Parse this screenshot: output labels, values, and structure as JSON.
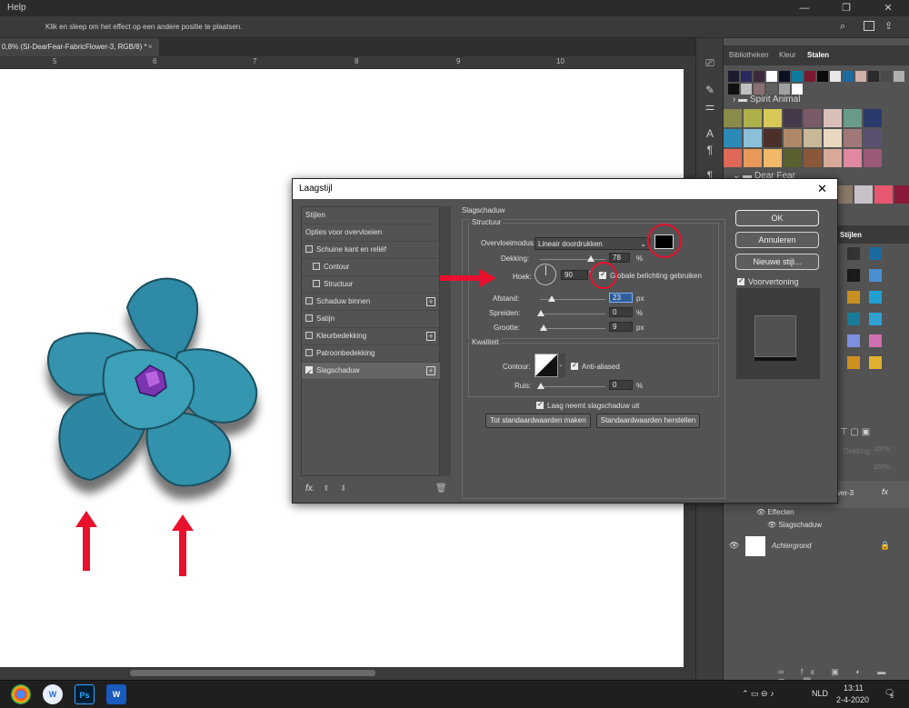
{
  "app": {
    "menu_label": "Help",
    "hint": "Klik en sleep om het effect op een andere positie te plaatsen.",
    "doc_tab": "0,8% (SI-DearFear-FabricFlower-3, RGB/8) *",
    "ruler_labels": [
      "5",
      "6",
      "7",
      "8",
      "9",
      "10"
    ]
  },
  "right_panel": {
    "tabs": [
      "Bibliotheken",
      "Kleur",
      "Stalen"
    ],
    "active_tab": "Stalen",
    "groups": [
      "Spirit Animal",
      "Dear Fear"
    ],
    "top_swatches": [
      "#1b1b2e",
      "#2a2a5e",
      "#3d2b3d",
      "#ffffff",
      "#0b1020",
      "#0d7ba0",
      "#7a1830",
      "#0a0a0a",
      "#e8e8e8",
      "#1a6aa0",
      "#d0b0a8",
      "#2a2a2a",
      "#4a4a4a",
      "#b0b0b0",
      "#101010",
      "#c0c0c0",
      "#8a7070",
      "#606060",
      "#a0a0a0",
      "#ffffff"
    ],
    "spirit_swatches": [
      "#8a8a4a",
      "#b0b04a",
      "#d8c858",
      "#44384a",
      "#7a5a68",
      "#d8c0b8",
      "#6a9a88",
      "#2a3a6a",
      "#2a8ab8",
      "#8ac0d8",
      "#4a3028",
      "#b08868",
      "#c8b898",
      "#e8d8c0",
      "#a07878",
      "#5a5070",
      "#e06858",
      "#e89858",
      "#f0b868",
      "#5a6030",
      "#8a5838",
      "#d8a898",
      "#e088a0",
      "#9a5a78"
    ],
    "dear_swatches": [
      "#f0f0f0",
      "#8a7a6a",
      "#c8c0c8",
      "#e85870",
      "#8a1838"
    ],
    "layers": {
      "tab": "Stijlen",
      "opacity_label": "Dekking:",
      "opacity_value": "100%",
      "fill_value": "100%",
      "layer_name": "Flower-3",
      "effects_label": "Effecten",
      "effect_item": "Slagschaduw",
      "background_name": "Achtergrond"
    }
  },
  "dialog": {
    "title": "Laagstijl",
    "left_items": [
      {
        "label": "Stijlen",
        "checkbox": false,
        "checked": false,
        "plus": false
      },
      {
        "label": "Opties voor overvloeien",
        "checkbox": false,
        "checked": false,
        "plus": false
      },
      {
        "label": "Schuine kant en reliëf",
        "checkbox": true,
        "checked": false,
        "plus": false
      },
      {
        "label": "Contour",
        "checkbox": true,
        "checked": false,
        "plus": false
      },
      {
        "label": "Structuur",
        "checkbox": true,
        "checked": false,
        "plus": false
      },
      {
        "label": "Schaduw binnen",
        "checkbox": true,
        "checked": false,
        "plus": true
      },
      {
        "label": "Satijn",
        "checkbox": true,
        "checked": false,
        "plus": false
      },
      {
        "label": "Kleurbedekking",
        "checkbox": true,
        "checked": false,
        "plus": true
      },
      {
        "label": "Patroonbedekking",
        "checkbox": true,
        "checked": false,
        "plus": false
      },
      {
        "label": "Slagschaduw",
        "checkbox": true,
        "checked": true,
        "plus": true
      }
    ],
    "section_title": "Slagschaduw",
    "structure": {
      "title": "Structuur",
      "blend_label": "Overvloeimodus:",
      "blend_value": "Lineair doordrukken",
      "shadow_color": "#000000",
      "opacity_label": "Dekking:",
      "opacity_value": "78",
      "opacity_unit": "%",
      "opacity_level": 0.78,
      "angle_label": "Hoek:",
      "angle_value": "90",
      "angle_unit": "°",
      "global_light_label": "Globale belichting gebruiken",
      "global_light_checked": true,
      "distance_label": "Afstand:",
      "distance_value": "23",
      "distance_unit": "px",
      "spread_label": "Spreiden:",
      "spread_value": "0",
      "spread_unit": "%",
      "size_label": "Grootte:",
      "size_value": "9",
      "size_unit": "px"
    },
    "quality": {
      "title": "Kwaliteit",
      "contour_label": "Contour:",
      "antialiased_label": "Anti-aliased",
      "antialiased_checked": true,
      "noise_label": "Ruis:",
      "noise_value": "0",
      "noise_unit": "%"
    },
    "knockout_label": "Laag neemt slagschaduw uit",
    "knockout_checked": true,
    "btn_make_default": "Tot standaardwaarden maken",
    "btn_reset_default": "Standaardwaarden herstellen",
    "btn_ok": "OK",
    "btn_cancel": "Annuleren",
    "btn_new_style": "Nieuwe stijl...",
    "preview_label": "Voorvertoning",
    "preview_checked": true
  },
  "taskbar": {
    "time": "13:11",
    "date": "2-4-2020",
    "lang": "NLD",
    "notif": "9"
  }
}
